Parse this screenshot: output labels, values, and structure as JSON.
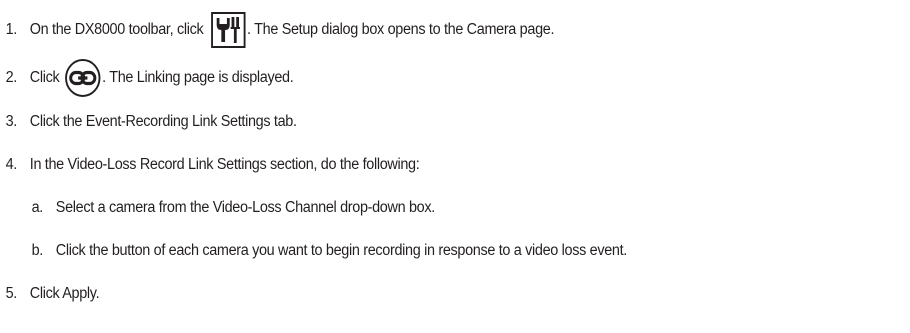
{
  "steps": [
    {
      "number": "1.",
      "before": "On the DX8000 toolbar, click",
      "icon": "wrench-screwdriver-icon",
      "after": ". The Setup dialog box opens to the Camera page."
    },
    {
      "number": "2.",
      "before": "Click",
      "icon": "link-icon",
      "after": ". The Linking page is displayed."
    },
    {
      "number": "3.",
      "text": "Click the Event-Recording Link Settings tab."
    },
    {
      "number": "4.",
      "text": "In the Video-Loss Record Link Settings section, do the following:"
    },
    {
      "number": "a.",
      "text": "Select a camera from the Video-Loss Channel drop-down box."
    },
    {
      "number": "b.",
      "text": "Click the button of each camera you want to begin recording in response to a video loss event."
    },
    {
      "number": "5.",
      "text": "Click Apply."
    }
  ]
}
